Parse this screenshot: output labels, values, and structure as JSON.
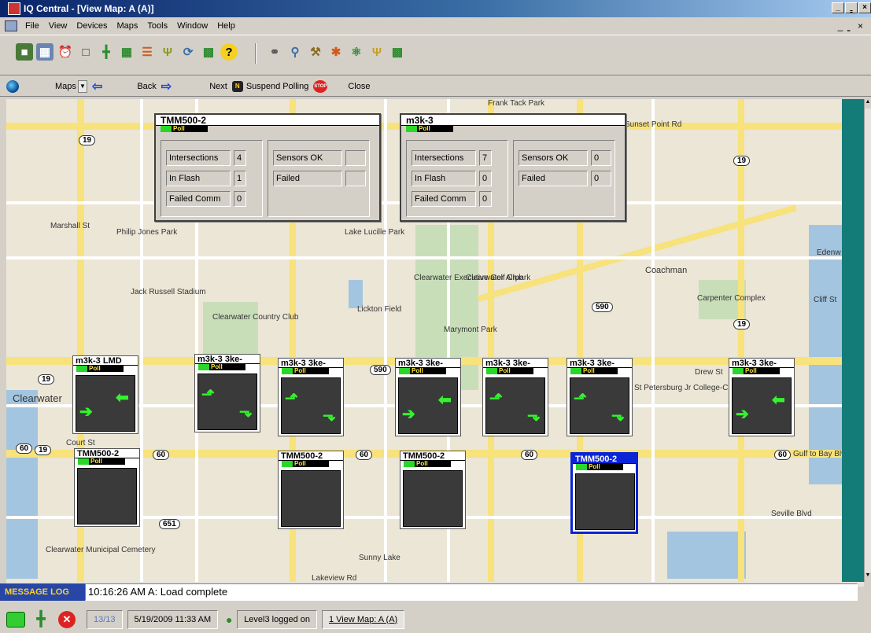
{
  "window": {
    "title": "IQ Central - [View Map:  A (A)]",
    "minimize": "_",
    "restore": "̳",
    "close": "×"
  },
  "menu": {
    "items": [
      "File",
      "View",
      "Devices",
      "Maps",
      "Tools",
      "Window",
      "Help"
    ],
    "mdi_controls": "_ ̳ ×"
  },
  "nav": {
    "maps_label": "Maps",
    "back_label": "Back",
    "next_label": "Next",
    "suspend_label": "Suspend Polling",
    "close_label": "Close"
  },
  "map": {
    "labels": [
      "Clearwater",
      "Marshall St",
      "Jack Russell Stadium",
      "Clearwater Country Club",
      "Lickton Field",
      "Marymont Park",
      "Clearwater Executive Golf Club",
      "Clearwater Airpark",
      "Coachman",
      "Carpenter Complex",
      "St Petersburg Jr College-Clearwater",
      "Drew St",
      "Court St",
      "Gulf to Bay Blvd",
      "Sunny Lake",
      "Lakeview Rd",
      "Clearwater Municipal Cemetery",
      "Seville Blvd",
      "Lake Lucille Park",
      "Philip Jones Park",
      "Frank Tack Park",
      "Sunset Point Rd",
      "Edenw",
      "Cliff St"
    ],
    "shields": [
      "19",
      "19",
      "590",
      "590",
      "60",
      "60",
      "60",
      "60",
      "60",
      "651",
      "19",
      "19",
      "19"
    ]
  },
  "summary_panels": [
    {
      "name": "TMM500-2",
      "poll": "Poll",
      "intersections_label": "Intersections",
      "intersections": "4",
      "in_flash_label": "In Flash",
      "in_flash": "1",
      "failed_comm_label": "Failed Comm",
      "failed_comm": "0",
      "sensors_ok_label": "Sensors OK",
      "sensors_ok": "",
      "failed_label": "Failed",
      "failed": ""
    },
    {
      "name": "m3k-3",
      "poll": "Poll",
      "intersections_label": "Intersections",
      "intersections": "7",
      "in_flash_label": "In Flash",
      "in_flash": "0",
      "failed_comm_label": "Failed Comm",
      "failed_comm": "0",
      "sensors_ok_label": "Sensors OK",
      "sensors_ok": "0",
      "failed_label": "Failed",
      "failed": "0"
    }
  ],
  "tiles": [
    {
      "name": "m3k-3 LMD",
      "poll": "Poll"
    },
    {
      "name": "m3k-3 3ke-",
      "poll": "Poll"
    },
    {
      "name": "m3k-3 3ke-",
      "poll": "Poll"
    },
    {
      "name": "m3k-3 3ke-",
      "poll": "Poll"
    },
    {
      "name": "m3k-3 3ke-",
      "poll": "Poll"
    },
    {
      "name": "m3k-3 3ke-",
      "poll": "Poll"
    },
    {
      "name": "m3k-3 3ke-",
      "poll": "Poll"
    },
    {
      "name": "TMM500-2",
      "poll": "Poll"
    },
    {
      "name": "TMM500-2",
      "poll": "Poll"
    },
    {
      "name": "TMM500-2",
      "poll": "Poll"
    },
    {
      "name": "TMM500-2",
      "poll": "Poll"
    }
  ],
  "message_log": {
    "label": "MESSAGE LOG",
    "text": "10:16:26 AM  A: Load complete"
  },
  "status": {
    "count": "13/13",
    "datetime": "5/19/2009  11:33 AM",
    "user": "Level3 logged on",
    "window_item": "1 View Map:  A (A)"
  },
  "colors": {
    "signal_green": "#35f32f",
    "selected_border": "#0b24d6",
    "map_road": "#f7e27c",
    "teal_strip": "#147c78"
  }
}
